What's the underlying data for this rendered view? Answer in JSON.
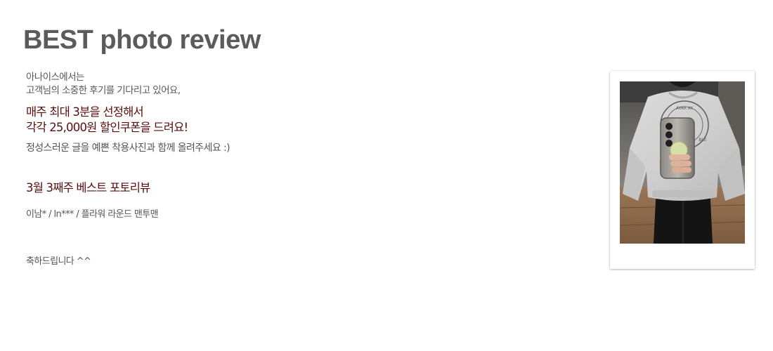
{
  "header": {
    "title": "BEST photo review"
  },
  "intro": {
    "line1": "아나이스에서는",
    "line2": "고객님의 소중한 후기를 기다리고 있어요,"
  },
  "highlight": {
    "line1": "매주 최대 3분을 선정해서",
    "line2": "각각 25,000원 할인쿠폰을 드려요!"
  },
  "request": "정성스러운 글을 예쁜 착용사진과 함께 올려주세요 :)",
  "weekly": {
    "heading": "3월 3째주 베스트 포토리뷰",
    "winner": "이남* / ln*** / 플라워 라운드 맨투맨",
    "congrats": "축하드립니다 ^^"
  },
  "photo": {
    "subject": "mirror-selfie-gray-sweatshirt-with-phone"
  },
  "colors": {
    "title": "#5b5b5b",
    "body": "#555555",
    "accent": "#5a0d0d"
  }
}
